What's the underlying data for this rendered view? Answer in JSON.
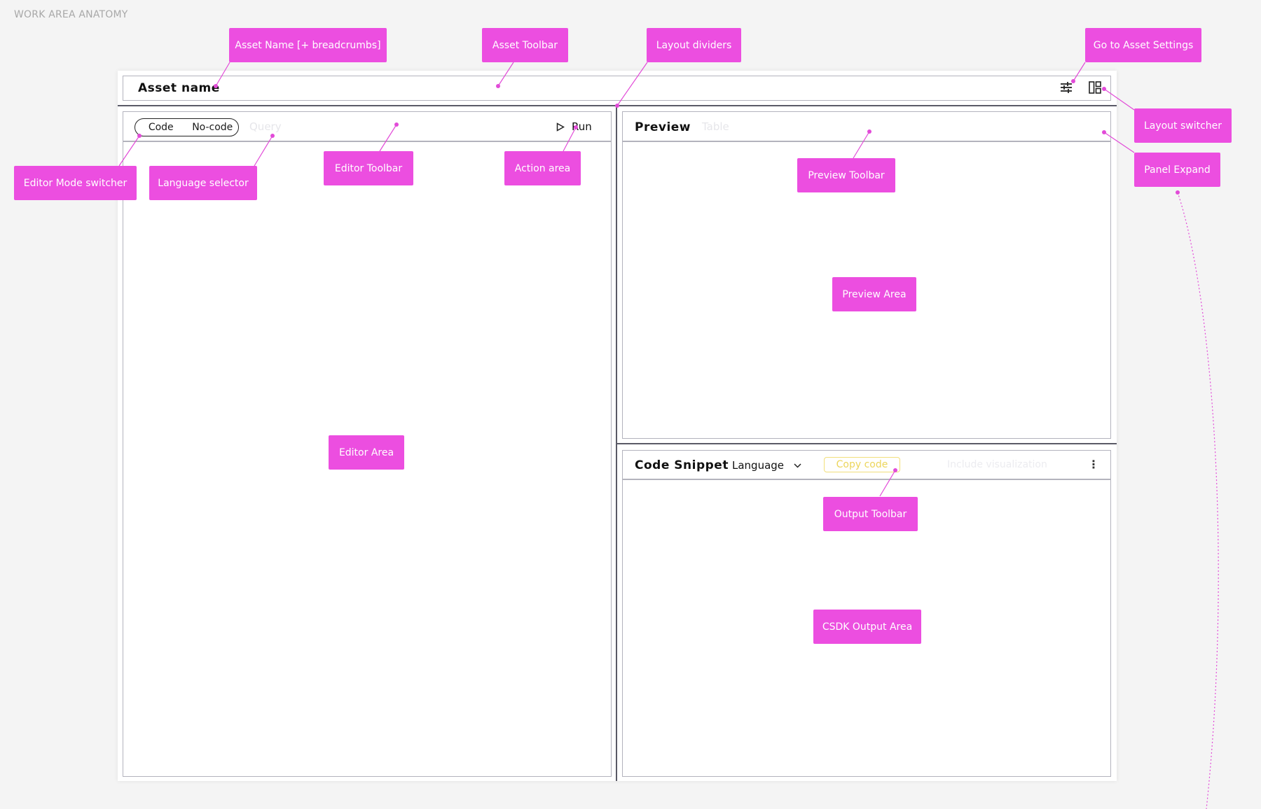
{
  "page_title": "WORK AREA ANATOMY",
  "asset": {
    "name": "Asset name"
  },
  "editor": {
    "mode_options": [
      "Code",
      "No-code"
    ],
    "language_hint": "Query",
    "run_label": "Run"
  },
  "preview": {
    "title": "Preview",
    "faded_tab": "Table"
  },
  "code_snippet": {
    "title": "Code Snippet",
    "language_label": "Language",
    "copy_label": "Copy code",
    "faded_option": "Include visualization"
  },
  "annotations": {
    "asset_name": "Asset Name [+ breadcrumbs]",
    "asset_toolbar": "Asset Toolbar",
    "layout_dividers": "Layout dividers",
    "asset_settings": "Go to Asset Settings",
    "layout_switcher": "Layout switcher",
    "panel_expand": "Panel Expand",
    "editor_mode_switcher": "Editor Mode switcher",
    "language_selector": "Language selector",
    "editor_toolbar": "Editor Toolbar",
    "action_area": "Action area",
    "preview_toolbar": "Preview Toolbar",
    "preview_area": "Preview Area",
    "editor_area": "Editor Area",
    "output_toolbar": "Output Toolbar",
    "csdk_output_area": "CSDK Output Area"
  },
  "colors": {
    "annotation": "#ec4ee0",
    "copy_accent": "#ecd55a",
    "divider": "#5a5a66"
  },
  "icons": [
    "sliders-icon",
    "layout-icon",
    "play-icon",
    "chevron-down-icon",
    "kebab-icon"
  ]
}
